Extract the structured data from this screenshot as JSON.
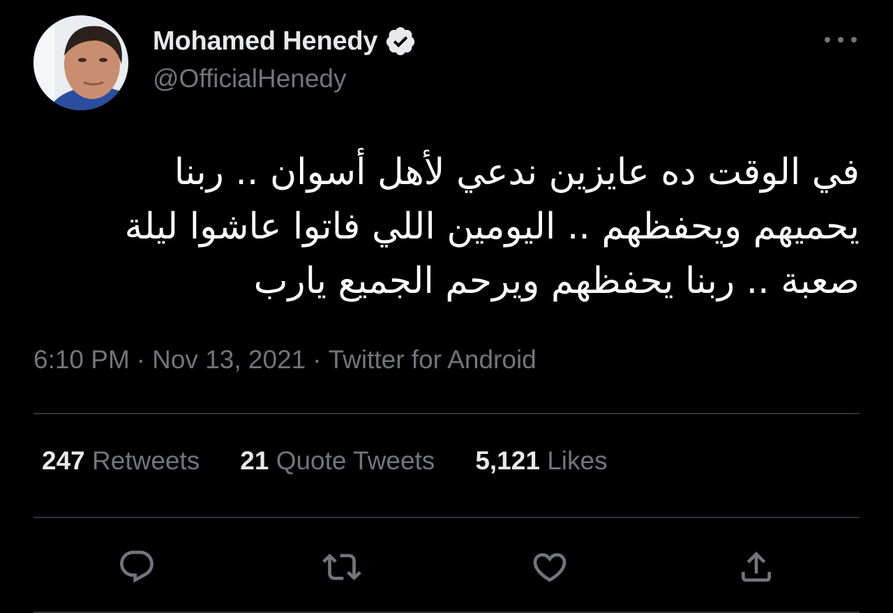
{
  "author": {
    "display_name": "Mohamed Henedy",
    "handle": "@OfficialHenedy",
    "verified": true
  },
  "tweet": {
    "text": "في الوقت ده عايزين ندعي لأهل أسوان .. ربنا يحميهم ويحفظهم .. اليومين اللي فاتوا عاشوا ليلة صعبة .. ربنا يحفظهم ويرحم الجميع يارب",
    "time": "6:10 PM",
    "date": "Nov 13, 2021",
    "source": "Twitter for Android",
    "separator": "·"
  },
  "stats": {
    "retweets_count": "247",
    "retweets_label": "Retweets",
    "quotes_count": "21",
    "quotes_label": "Quote Tweets",
    "likes_count": "5,121",
    "likes_label": "Likes"
  },
  "icons": {
    "more": "more-horizontal-icon",
    "verified": "verified-badge-icon",
    "reply": "reply-icon",
    "retweet": "retweet-icon",
    "like": "heart-icon",
    "share": "share-icon"
  },
  "colors": {
    "background": "#000000",
    "primary_text": "#e7e9ea",
    "secondary_text": "#71767b",
    "divider": "#2f3336"
  }
}
